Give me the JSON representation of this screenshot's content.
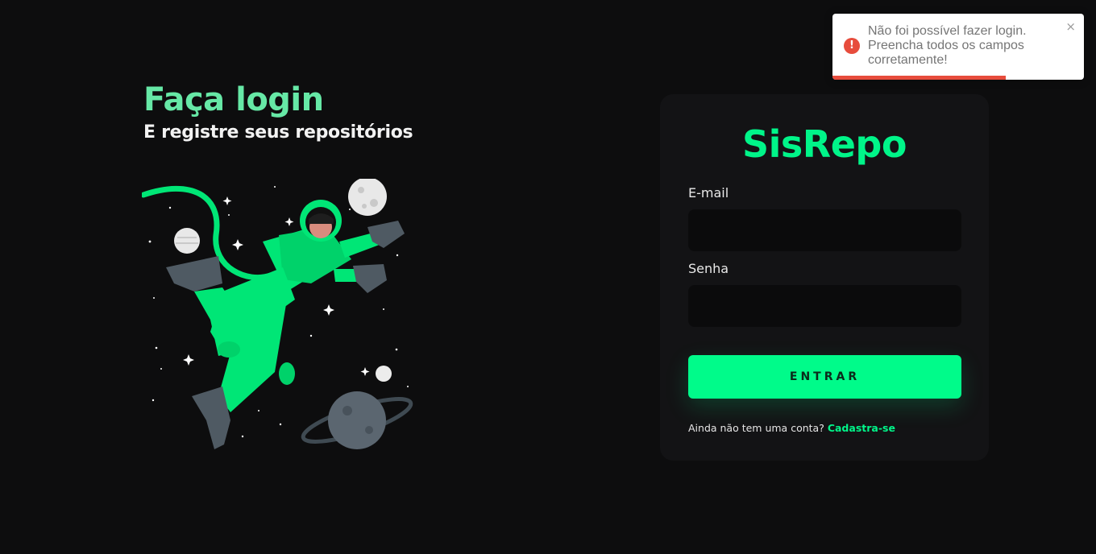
{
  "hero": {
    "title": "Faça login",
    "subtitle": "E registre seus repositórios"
  },
  "illustration": {
    "name": "astronaut-illustration",
    "colors": {
      "suit": "#00e676",
      "metal": "#4f5a63",
      "planet": "#e6e6e6"
    }
  },
  "login_card": {
    "brand": "SisRepo",
    "email_label": "E-mail",
    "email_value": "",
    "password_label": "Senha",
    "password_value": "",
    "submit_label": "ENTRAR",
    "signup_prompt": "Ainda não tem uma conta?",
    "signup_link": "Cadastra-se"
  },
  "toast": {
    "type": "error",
    "icon": "error-icon",
    "icon_glyph": "!",
    "message": "Não foi possível fazer login. Preencha todos os campos corretamente!",
    "close_glyph": "×",
    "progress": 0.69
  },
  "colors": {
    "background": "#0d0d0e",
    "accent": "#00f589",
    "title_green": "#66e8a6",
    "card": "#131315",
    "error": "#e74c3c"
  }
}
